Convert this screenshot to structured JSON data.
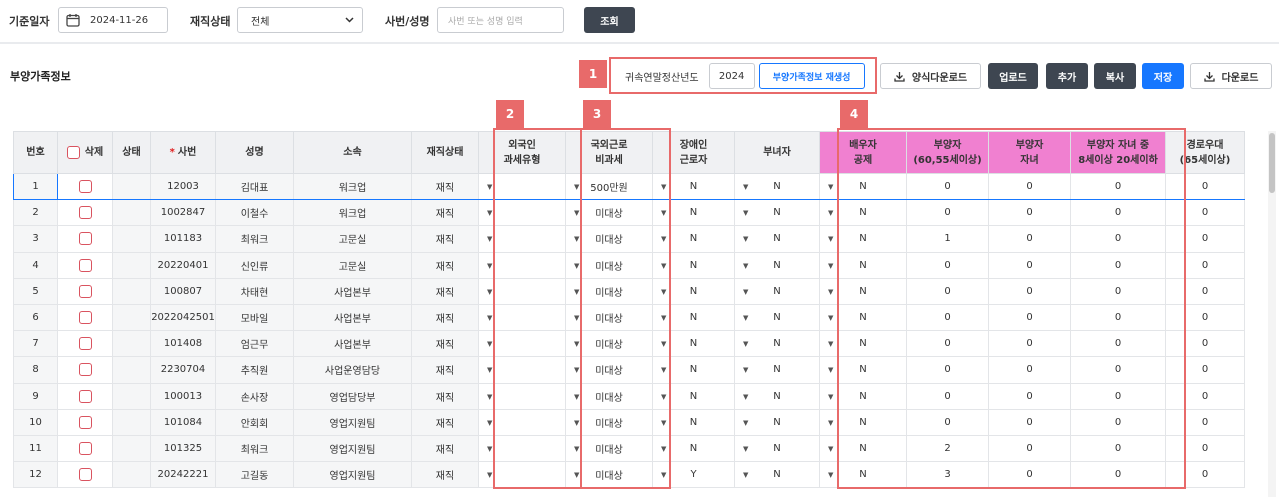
{
  "search": {
    "base_date_label": "기준일자",
    "base_date_value": "2024-11-26",
    "status_label": "재직상태",
    "status_value": "전체",
    "emp_label": "사번/성명",
    "emp_placeholder": "사번 또는 성명 입력",
    "search_button": "조회"
  },
  "section": {
    "title": "부양가족정보",
    "year_label": "귀속연말정산년도",
    "year_value": "2024",
    "regen_button": "부양가족정보 재생성",
    "template_download": "양식다운로드",
    "upload": "업로드",
    "add": "추가",
    "copy": "복사",
    "save": "저장",
    "download": "다운로드"
  },
  "badges": [
    "1",
    "2",
    "3",
    "4"
  ],
  "colors": {
    "highlight": "#e86a6a",
    "pink_header": "#f080d0",
    "primary": "#1677ff",
    "dark_button": "#3e4651"
  },
  "columns": [
    "번호",
    "삭제",
    "상태",
    "사번",
    "성명",
    "소속",
    "재직상태",
    "외국인\n과세유형",
    "국외근로\n비과세",
    "장애인\n근로자",
    "부녀자",
    "배우자\n공제",
    "부양자\n(60,55세이상)",
    "부양자\n자녀",
    "부양자 자녀 중\n8세이상 20세이하",
    "경로우대\n(65세이상)"
  ],
  "rows": [
    {
      "no": "1",
      "emp": "12003",
      "name": "김대표",
      "dept": "워크업",
      "status": "재직",
      "abroad": "500만원",
      "disabled": "N",
      "woman": "N",
      "spouse": "N",
      "dep60": "0",
      "depchild": "0",
      "child820": "0",
      "senior": "0"
    },
    {
      "no": "2",
      "emp": "1002847",
      "name": "이철수",
      "dept": "워크업",
      "status": "재직",
      "abroad": "미대상",
      "disabled": "N",
      "woman": "N",
      "spouse": "N",
      "dep60": "0",
      "depchild": "0",
      "child820": "0",
      "senior": "0"
    },
    {
      "no": "3",
      "emp": "101183",
      "name": "최워크",
      "dept": "고문실",
      "status": "재직",
      "abroad": "미대상",
      "disabled": "N",
      "woman": "N",
      "spouse": "N",
      "dep60": "1",
      "depchild": "0",
      "child820": "0",
      "senior": "0"
    },
    {
      "no": "4",
      "emp": "20220401",
      "name": "신인류",
      "dept": "고문실",
      "status": "재직",
      "abroad": "미대상",
      "disabled": "N",
      "woman": "N",
      "spouse": "N",
      "dep60": "0",
      "depchild": "0",
      "child820": "0",
      "senior": "0"
    },
    {
      "no": "5",
      "emp": "100807",
      "name": "차태현",
      "dept": "사업본부",
      "status": "재직",
      "abroad": "미대상",
      "disabled": "N",
      "woman": "N",
      "spouse": "N",
      "dep60": "0",
      "depchild": "0",
      "child820": "0",
      "senior": "0"
    },
    {
      "no": "6",
      "emp": "2022042501",
      "name": "모바일",
      "dept": "사업본부",
      "status": "재직",
      "abroad": "미대상",
      "disabled": "N",
      "woman": "N",
      "spouse": "N",
      "dep60": "0",
      "depchild": "0",
      "child820": "0",
      "senior": "0"
    },
    {
      "no": "7",
      "emp": "101408",
      "name": "엄근무",
      "dept": "사업본부",
      "status": "재직",
      "abroad": "미대상",
      "disabled": "N",
      "woman": "N",
      "spouse": "N",
      "dep60": "0",
      "depchild": "0",
      "child820": "0",
      "senior": "0"
    },
    {
      "no": "8",
      "emp": "2230704",
      "name": "추직원",
      "dept": "사업운영담당",
      "status": "재직",
      "abroad": "미대상",
      "disabled": "N",
      "woman": "N",
      "spouse": "N",
      "dep60": "0",
      "depchild": "0",
      "child820": "0",
      "senior": "0"
    },
    {
      "no": "9",
      "emp": "100013",
      "name": "손사장",
      "dept": "영업담당부",
      "status": "재직",
      "abroad": "미대상",
      "disabled": "N",
      "woman": "N",
      "spouse": "N",
      "dep60": "0",
      "depchild": "0",
      "child820": "0",
      "senior": "0"
    },
    {
      "no": "10",
      "emp": "101084",
      "name": "안회회",
      "dept": "영업지원팀",
      "status": "재직",
      "abroad": "미대상",
      "disabled": "N",
      "woman": "N",
      "spouse": "N",
      "dep60": "0",
      "depchild": "0",
      "child820": "0",
      "senior": "0"
    },
    {
      "no": "11",
      "emp": "101325",
      "name": "최워크",
      "dept": "영업지원팀",
      "status": "재직",
      "abroad": "미대상",
      "disabled": "N",
      "woman": "N",
      "spouse": "N",
      "dep60": "2",
      "depchild": "0",
      "child820": "0",
      "senior": "0"
    },
    {
      "no": "12",
      "emp": "20242221",
      "name": "고길동",
      "dept": "영업지원팀",
      "status": "재직",
      "abroad": "미대상",
      "disabled": "Y",
      "woman": "N",
      "spouse": "N",
      "dep60": "3",
      "depchild": "0",
      "child820": "0",
      "senior": "0"
    }
  ]
}
